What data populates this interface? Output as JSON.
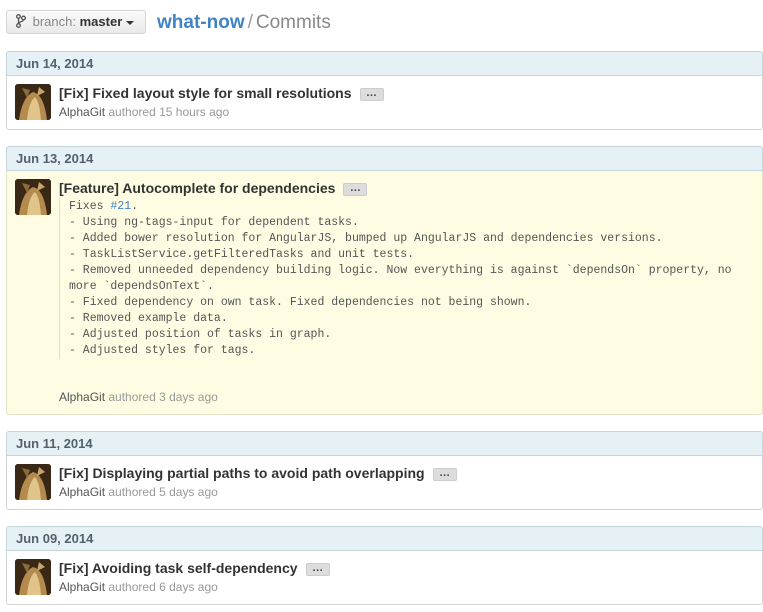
{
  "header": {
    "branch_label": "branch:",
    "branch_value": "master",
    "repo_name": "what-now",
    "separator": "/",
    "page_name": "Commits"
  },
  "groups": [
    {
      "date": "Jun 14, 2014",
      "commits": [
        {
          "title": "[Fix] Fixed layout style for small resolutions",
          "ellipsis": "…",
          "author": "AlphaGit",
          "verb": "authored",
          "time": "15 hours ago"
        }
      ]
    },
    {
      "date": "Jun 13, 2014",
      "commits": [
        {
          "title": "[Feature] Autocomplete for dependencies",
          "ellipsis": "…",
          "selected": true,
          "description": {
            "fixes_prefix": "Fixes ",
            "issue_ref": "#21",
            "fixes_suffix": ".",
            "body": "\n- Using ng-tags-input for dependent tasks.\n- Added bower resolution for AngularJS, bumped up AngularJS and dependencies versions.\n- TaskListService.getFilteredTasks and unit tests.\n- Removed unneeded dependency building logic. Now everything is against `dependsOn` property, no more `dependsOnText`.\n- Fixed dependency on own task. Fixed dependencies not being shown.\n- Removed example data.\n- Adjusted position of tasks in graph.\n- Adjusted styles for tags."
          },
          "author": "AlphaGit",
          "verb": "authored",
          "time": "3 days ago"
        }
      ]
    },
    {
      "date": "Jun 11, 2014",
      "commits": [
        {
          "title": "[Fix] Displaying partial paths to avoid path overlapping",
          "ellipsis": "…",
          "author": "AlphaGit",
          "verb": "authored",
          "time": "5 days ago"
        }
      ]
    },
    {
      "date": "Jun 09, 2014",
      "commits": [
        {
          "title": "[Fix] Avoiding task self-dependency",
          "ellipsis": "…",
          "author": "AlphaGit",
          "verb": "authored",
          "time": "6 days ago"
        }
      ]
    }
  ],
  "colors": {
    "link": "#4183c4",
    "day_header_bg": "#e6f1f6",
    "selected_bg": "#fefde3"
  }
}
